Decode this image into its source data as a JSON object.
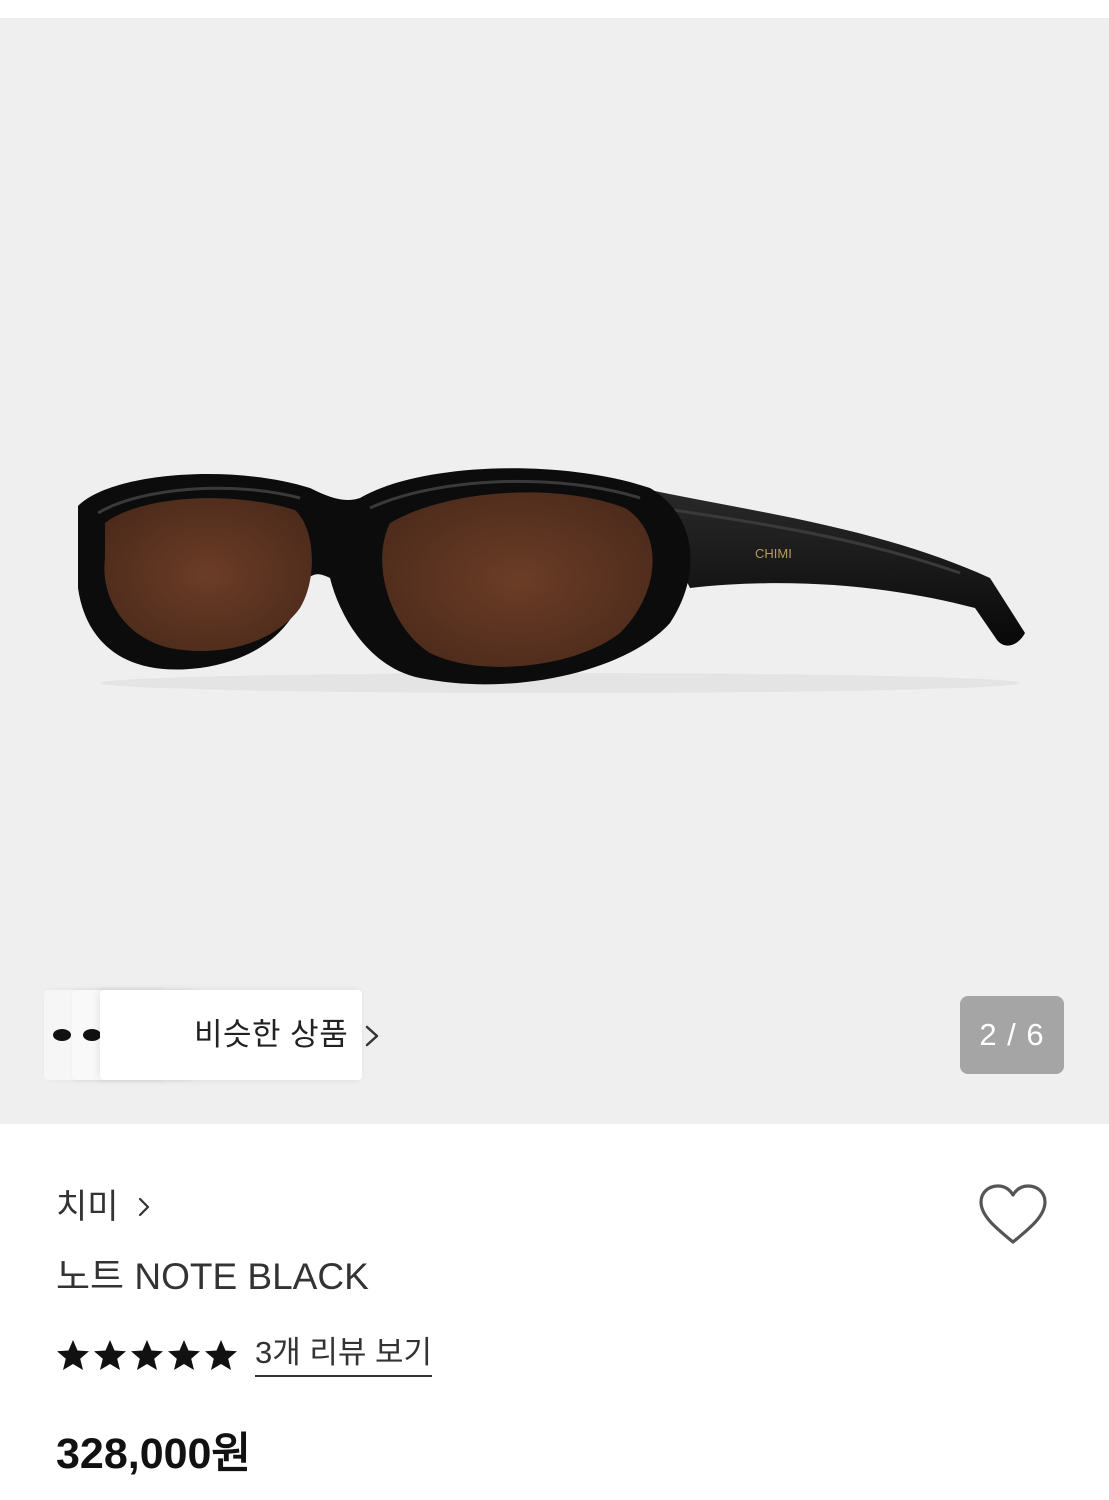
{
  "gallery": {
    "image": {
      "alt": "Black oval sunglasses with brown lenses",
      "frame_engraving": "CHIMI"
    },
    "similar_products": {
      "label": "비슷한 상품"
    },
    "counter": {
      "current": "2",
      "total": "6",
      "text": "2 / 6"
    }
  },
  "product": {
    "brand": "치미",
    "title": "노트 NOTE BLACK",
    "rating": {
      "stars": 5,
      "max": 5
    },
    "reviews_link": "3개 리뷰 보기",
    "price": "328,000원"
  },
  "colors": {
    "gallery_bg": "#efefef",
    "frame": "#0d0d0d",
    "lens": "#5a3220",
    "text": "#222222",
    "counter_bg": "#8a8a8a"
  },
  "icons": {
    "similar_chevron": "chevron-right-icon",
    "brand_chevron": "chevron-right-icon",
    "wish": "heart-outline-icon",
    "star": "star-icon"
  }
}
